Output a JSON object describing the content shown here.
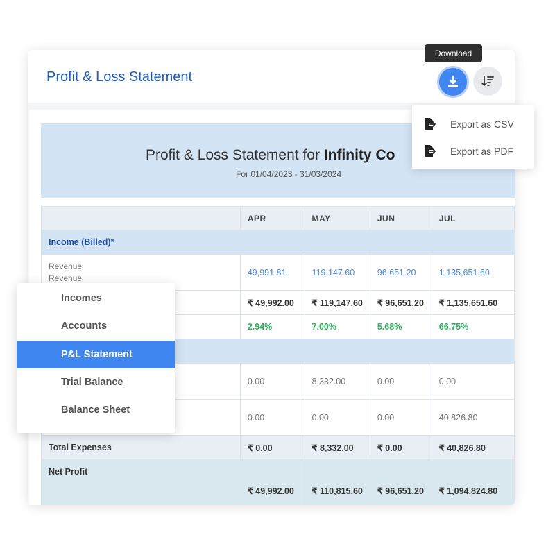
{
  "header": {
    "title": "Profit & Loss Statement",
    "download_tooltip": "Download"
  },
  "export_menu": {
    "items": [
      {
        "label": "Export as CSV",
        "icon": "file-export-icon"
      },
      {
        "label": "Export as PDF",
        "icon": "file-export-icon"
      }
    ]
  },
  "report": {
    "heading_prefix": "Profit & Loss Statement for ",
    "heading_company": "Infinity Co",
    "period": "For 01/04/2023 - 31/03/2024",
    "months": [
      "APR",
      "MAY",
      "JUN",
      "JUL"
    ],
    "income_section": "Income (Billed)*",
    "revenue_label_1": "Revenue",
    "revenue_label_2": "Revenue",
    "revenue_values": [
      "49,991.81",
      "119,147.60",
      "96,651.20",
      "1,135,651.60"
    ],
    "income_totals": [
      "₹ 49,992.00",
      "₹ 119,147.60",
      "₹ 96,651.20",
      "₹ 1,135,651.60"
    ],
    "percentages": [
      "2.94%",
      "7.00%",
      "5.68%",
      "66.75%"
    ],
    "expense_row_1": [
      "0.00",
      "8,332.00",
      "0.00",
      "0.00"
    ],
    "expense_row_2": [
      "0.00",
      "0.00",
      "0.00",
      "40,826.80"
    ],
    "total_expenses_label": "Total Expenses",
    "total_expenses": [
      "₹ 0.00",
      "₹ 8,332.00",
      "₹ 0.00",
      "₹ 40,826.80"
    ],
    "net_profit_label": "Net Profit",
    "net_profit": [
      "₹ 49,992.00",
      "₹ 110,815.60",
      "₹ 96,651.20",
      "₹ 1,094,824.80"
    ]
  },
  "side_menu": {
    "items": [
      "Incomes",
      "Accounts",
      "P&L Statement",
      "Trial Balance",
      "Balance Sheet"
    ],
    "active": "P&L Statement"
  },
  "colors": {
    "accent": "#3f86f0",
    "title_blue": "#1f5fb8",
    "section_bg": "#d3e4f4",
    "positive_green": "#2bb35f",
    "link_blue": "#4a89d8"
  }
}
